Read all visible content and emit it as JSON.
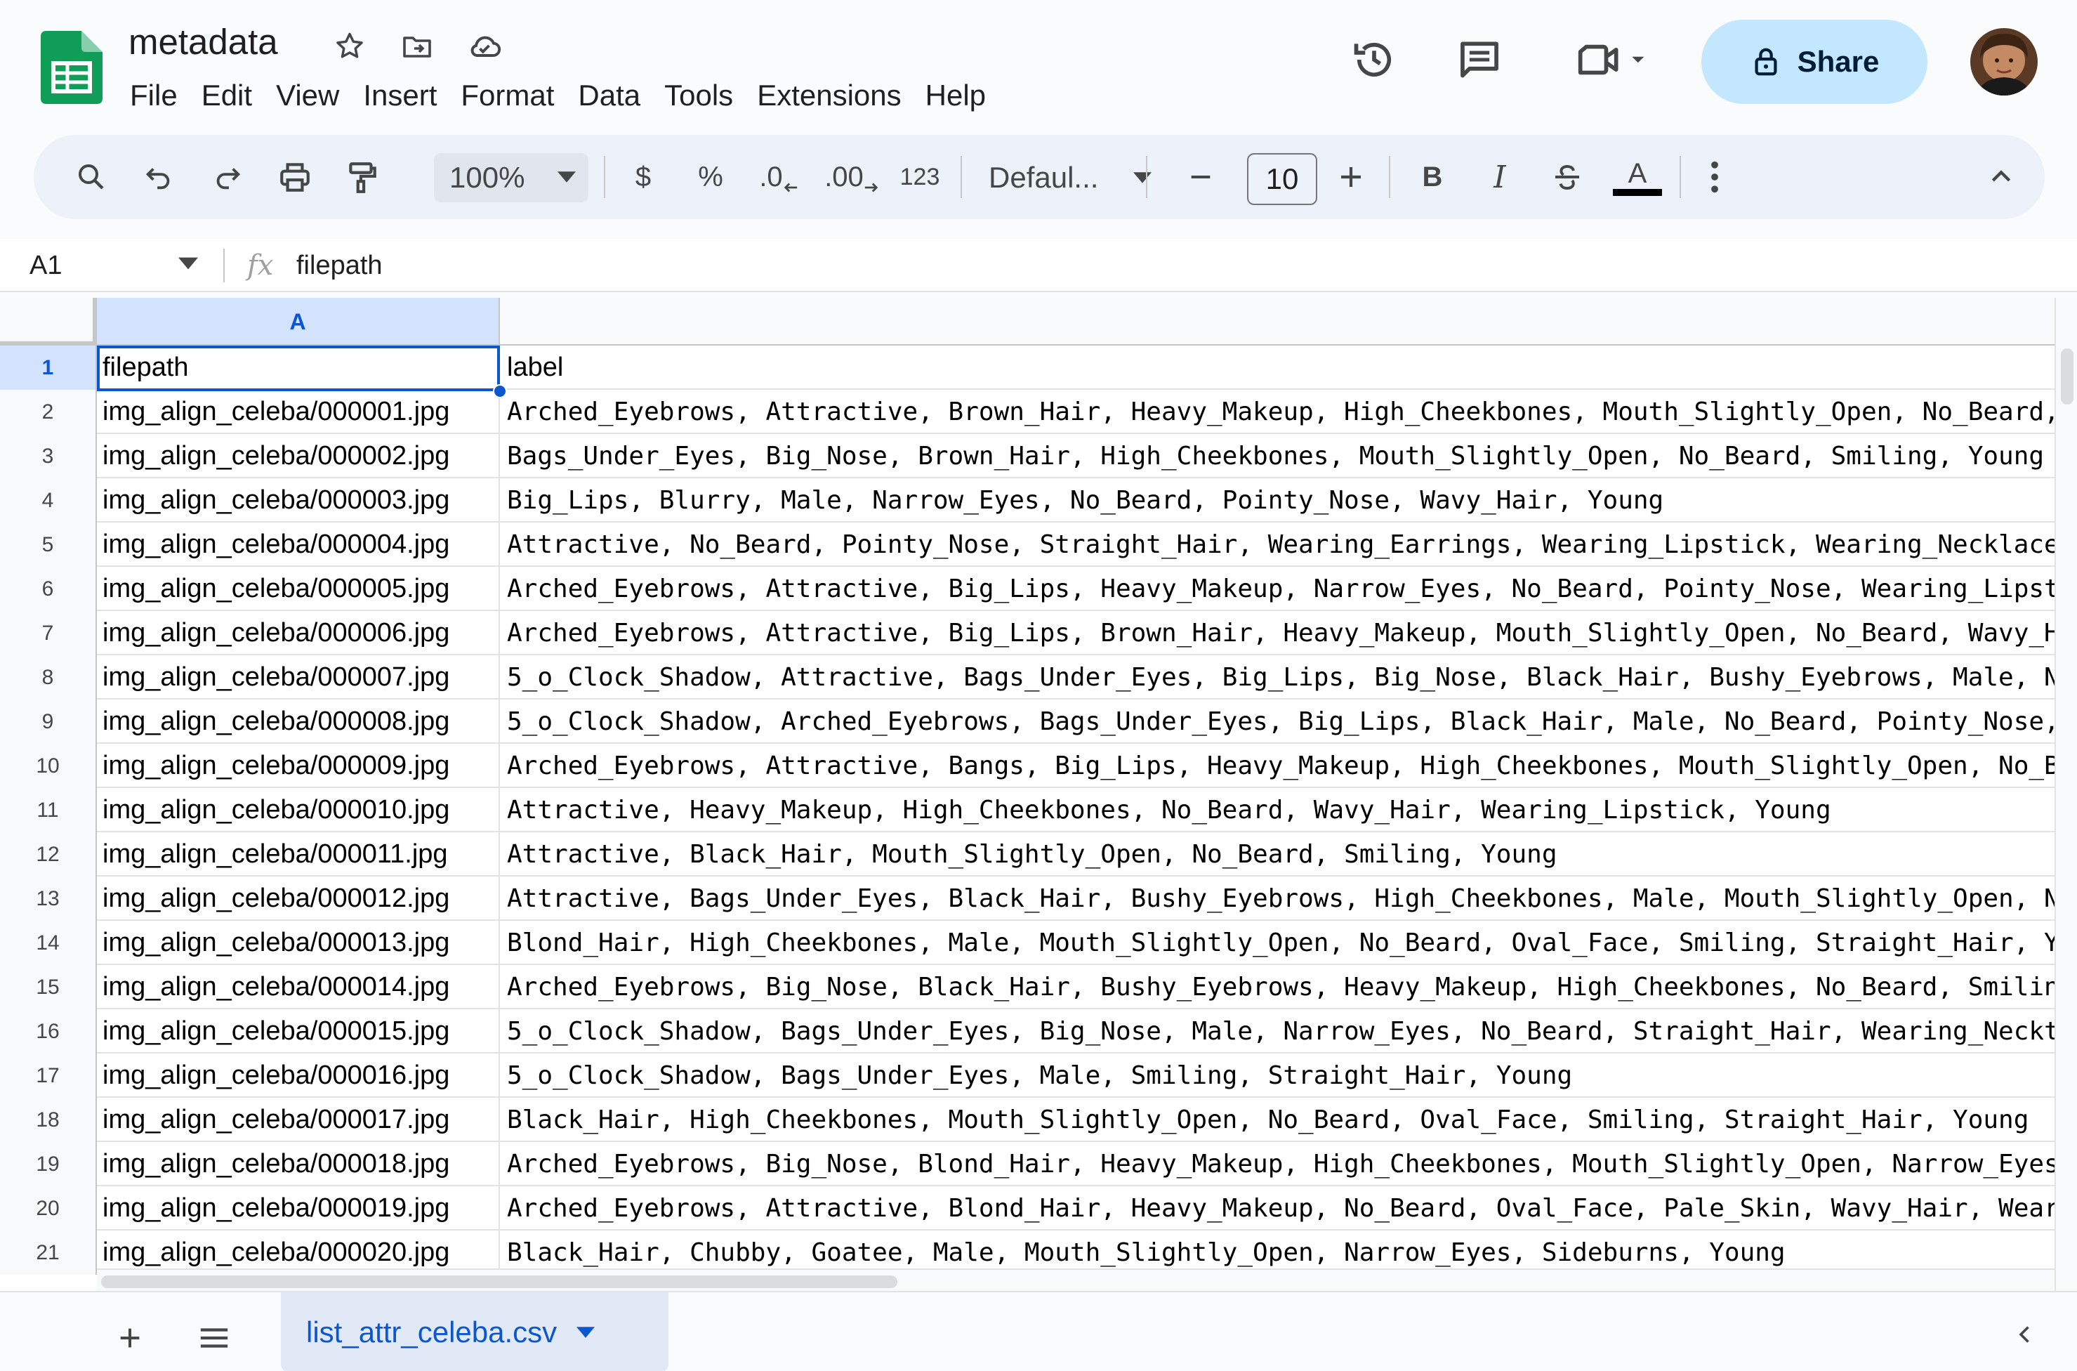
{
  "header": {
    "title": "metadata",
    "menu": [
      "File",
      "Edit",
      "View",
      "Insert",
      "Format",
      "Data",
      "Tools",
      "Extensions",
      "Help"
    ],
    "share_label": "Share"
  },
  "toolbar": {
    "zoom": "100%",
    "currency": "$",
    "percent": "%",
    "decrease_decimal": ".0",
    "increase_decimal": ".00",
    "number_format": "123",
    "font": "Defaul...",
    "font_size": "10",
    "bold": "B",
    "italic": "I",
    "text_color": "A"
  },
  "formula_bar": {
    "cell_ref": "A1",
    "content": "filepath"
  },
  "grid": {
    "column_headers": [
      "A"
    ],
    "rows": [
      {
        "n": "1",
        "a": "filepath",
        "b": "label"
      },
      {
        "n": "2",
        "a": "img_align_celeba/000001.jpg",
        "b": "Arched_Eyebrows, Attractive, Brown_Hair, Heavy_Makeup, High_Cheekbones, Mouth_Slightly_Open, No_Beard,"
      },
      {
        "n": "3",
        "a": "img_align_celeba/000002.jpg",
        "b": "Bags_Under_Eyes, Big_Nose, Brown_Hair, High_Cheekbones, Mouth_Slightly_Open, No_Beard, Smiling, Young"
      },
      {
        "n": "4",
        "a": "img_align_celeba/000003.jpg",
        "b": "Big_Lips, Blurry, Male, Narrow_Eyes, No_Beard, Pointy_Nose, Wavy_Hair, Young"
      },
      {
        "n": "5",
        "a": "img_align_celeba/000004.jpg",
        "b": "Attractive, No_Beard, Pointy_Nose, Straight_Hair, Wearing_Earrings, Wearing_Lipstick, Wearing_Necklace"
      },
      {
        "n": "6",
        "a": "img_align_celeba/000005.jpg",
        "b": "Arched_Eyebrows, Attractive, Big_Lips, Heavy_Makeup, Narrow_Eyes, No_Beard, Pointy_Nose, Wearing_Lipst"
      },
      {
        "n": "7",
        "a": "img_align_celeba/000006.jpg",
        "b": "Arched_Eyebrows, Attractive, Big_Lips, Brown_Hair, Heavy_Makeup, Mouth_Slightly_Open, No_Beard, Wavy_H"
      },
      {
        "n": "8",
        "a": "img_align_celeba/000007.jpg",
        "b": "5_o_Clock_Shadow, Attractive, Bags_Under_Eyes, Big_Lips, Big_Nose, Black_Hair, Bushy_Eyebrows, Male, N"
      },
      {
        "n": "9",
        "a": "img_align_celeba/000008.jpg",
        "b": "5_o_Clock_Shadow, Arched_Eyebrows, Bags_Under_Eyes, Big_Lips, Black_Hair, Male, No_Beard, Pointy_Nose,"
      },
      {
        "n": "10",
        "a": "img_align_celeba/000009.jpg",
        "b": "Arched_Eyebrows, Attractive, Bangs, Big_Lips, Heavy_Makeup, High_Cheekbones, Mouth_Slightly_Open, No_B"
      },
      {
        "n": "11",
        "a": "img_align_celeba/000010.jpg",
        "b": "Attractive, Heavy_Makeup, High_Cheekbones, No_Beard, Wavy_Hair, Wearing_Lipstick, Young"
      },
      {
        "n": "12",
        "a": "img_align_celeba/000011.jpg",
        "b": "Attractive, Black_Hair, Mouth_Slightly_Open, No_Beard, Smiling, Young"
      },
      {
        "n": "13",
        "a": "img_align_celeba/000012.jpg",
        "b": "Attractive, Bags_Under_Eyes, Black_Hair, Bushy_Eyebrows, High_Cheekbones, Male, Mouth_Slightly_Open, N"
      },
      {
        "n": "14",
        "a": "img_align_celeba/000013.jpg",
        "b": "Blond_Hair, High_Cheekbones, Male, Mouth_Slightly_Open, No_Beard, Oval_Face, Smiling, Straight_Hair, Y"
      },
      {
        "n": "15",
        "a": "img_align_celeba/000014.jpg",
        "b": "Arched_Eyebrows, Big_Nose, Black_Hair, Bushy_Eyebrows, Heavy_Makeup, High_Cheekbones, No_Beard, Smilin"
      },
      {
        "n": "16",
        "a": "img_align_celeba/000015.jpg",
        "b": "5_o_Clock_Shadow, Bags_Under_Eyes, Big_Nose, Male, Narrow_Eyes, No_Beard, Straight_Hair, Wearing_Neckt"
      },
      {
        "n": "17",
        "a": "img_align_celeba/000016.jpg",
        "b": "5_o_Clock_Shadow, Bags_Under_Eyes, Male, Smiling, Straight_Hair, Young"
      },
      {
        "n": "18",
        "a": "img_align_celeba/000017.jpg",
        "b": "Black_Hair, High_Cheekbones, Mouth_Slightly_Open, No_Beard, Oval_Face, Smiling, Straight_Hair, Young"
      },
      {
        "n": "19",
        "a": "img_align_celeba/000018.jpg",
        "b": "Arched_Eyebrows, Big_Nose, Blond_Hair, Heavy_Makeup, High_Cheekbones, Mouth_Slightly_Open, Narrow_Eyes"
      },
      {
        "n": "20",
        "a": "img_align_celeba/000019.jpg",
        "b": "Arched_Eyebrows, Attractive, Blond_Hair, Heavy_Makeup, No_Beard, Oval_Face, Pale_Skin, Wavy_Hair, Wear"
      },
      {
        "n": "21",
        "a": "img_align_celeba/000020.jpg",
        "b": "Black_Hair, Chubby, Goatee, Male, Mouth_Slightly_Open, Narrow_Eyes, Sideburns, Young"
      }
    ]
  },
  "sheet_tabs": [
    {
      "label": "list_attr_celeba.csv",
      "active": true
    }
  ],
  "colors": {
    "accent": "#0b57d0",
    "share_bg": "#c2e7ff",
    "sheets_green": "#0f9d58",
    "selected_header": "#d3e3fd"
  },
  "icons": {
    "title_row": [
      "star-icon",
      "move-to-folder-icon",
      "cloud-saved-icon"
    ],
    "header_right": [
      "version-history-icon",
      "comment-icon",
      "meet-icon"
    ]
  }
}
